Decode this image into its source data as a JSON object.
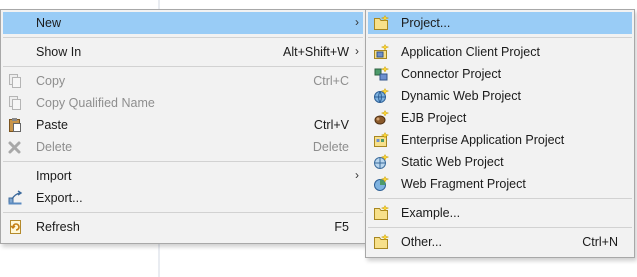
{
  "main_menu": {
    "items": [
      {
        "label": "New",
        "shortcut": "",
        "submenu": true,
        "enabled": true,
        "highlighted": true
      },
      {
        "label": "Show In",
        "shortcut": "Alt+Shift+W",
        "submenu": true,
        "enabled": true
      },
      {
        "label": "Copy",
        "shortcut": "Ctrl+C",
        "enabled": false,
        "icon": "copy-icon"
      },
      {
        "label": "Copy Qualified Name",
        "shortcut": "",
        "enabled": false,
        "icon": "copy-qualified-name-icon"
      },
      {
        "label": "Paste",
        "shortcut": "Ctrl+V",
        "enabled": true,
        "icon": "paste-icon"
      },
      {
        "label": "Delete",
        "shortcut": "Delete",
        "enabled": false,
        "icon": "delete-icon"
      },
      {
        "label": "Import",
        "shortcut": "",
        "submenu": true,
        "enabled": true
      },
      {
        "label": "Export...",
        "shortcut": "",
        "enabled": true,
        "icon": "export-icon"
      },
      {
        "label": "Refresh",
        "shortcut": "F5",
        "enabled": true,
        "icon": "refresh-icon"
      }
    ],
    "arrow": "›"
  },
  "new_submenu": {
    "items": [
      {
        "label": "Project...",
        "shortcut": "",
        "highlighted": true,
        "icon": "new-project-icon"
      },
      {
        "label": "Application Client Project",
        "icon": "application-client-project-icon"
      },
      {
        "label": "Connector Project",
        "icon": "connector-project-icon"
      },
      {
        "label": "Dynamic Web Project",
        "icon": "dynamic-web-project-icon"
      },
      {
        "label": "EJB Project",
        "icon": "ejb-project-icon"
      },
      {
        "label": "Enterprise Application Project",
        "icon": "enterprise-application-project-icon"
      },
      {
        "label": "Static Web Project",
        "icon": "static-web-project-icon"
      },
      {
        "label": "Web Fragment Project",
        "icon": "web-fragment-project-icon"
      },
      {
        "label": "Example...",
        "icon": "example-icon"
      },
      {
        "label": "Other...",
        "shortcut": "Ctrl+N",
        "icon": "other-wizard-icon"
      }
    ]
  },
  "colors": {
    "highlight": "#99ccf6",
    "menu_background": "#f2f2f2",
    "disabled_text": "#8e8e8e"
  }
}
